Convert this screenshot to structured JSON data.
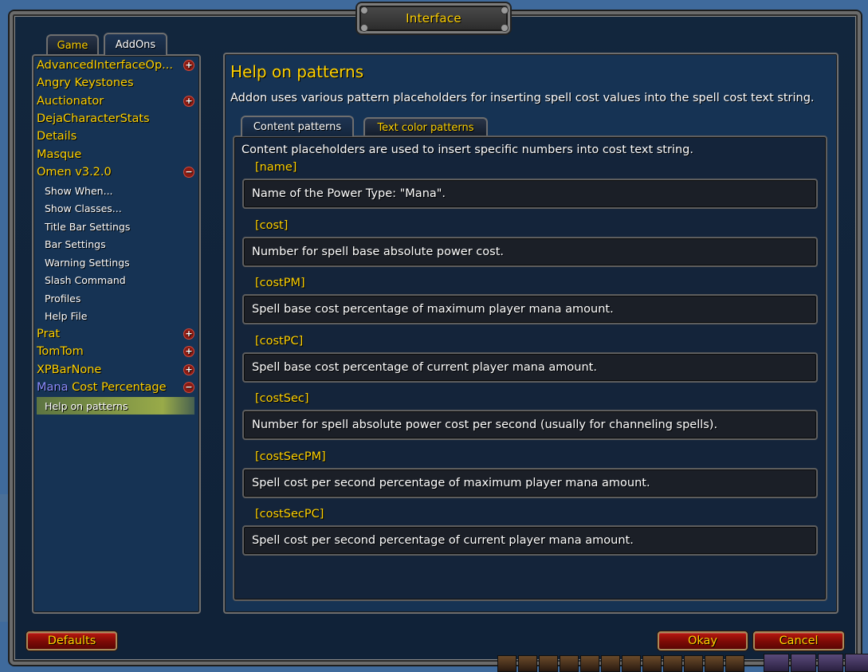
{
  "window": {
    "title": "Interface"
  },
  "tabs": {
    "game": "Game",
    "addons": "AddOns"
  },
  "sidebar": {
    "categories": [
      {
        "label": "AdvancedInterfaceOp...",
        "toggle": "+"
      },
      {
        "label": "Angry Keystones"
      },
      {
        "label": "Auctionator",
        "toggle": "+"
      },
      {
        "label": "DejaCharacterStats"
      },
      {
        "label": "Details"
      },
      {
        "label": "Masque"
      },
      {
        "label": "Omen v3.2.0",
        "toggle": "−"
      }
    ],
    "omen_children": [
      "Show When...",
      "Show Classes...",
      "Title Bar Settings",
      "Bar Settings",
      "Warning Settings",
      "Slash Command",
      "Profiles",
      "Help File"
    ],
    "categories_after": [
      {
        "label": "Prat",
        "toggle": "+"
      },
      {
        "label": "TomTom",
        "toggle": "+"
      },
      {
        "label": "XPBarNone",
        "toggle": "+"
      }
    ],
    "mana_category": {
      "label_highlight": "Mana",
      "label_rest": " Cost Percentage",
      "toggle": "−"
    },
    "selected_child": "Help on patterns"
  },
  "content": {
    "title": "Help on patterns",
    "description": "Addon uses various pattern placeholders for inserting spell cost values into the spell cost text string.",
    "tabs": {
      "content_patterns": "Content patterns",
      "text_color_patterns": "Text color patterns"
    },
    "intro": "Content placeholders are used to insert specific numbers into cost text string.",
    "placeholders": [
      {
        "name": "[name]",
        "description": "Name of the Power Type: \"Mana\"."
      },
      {
        "name": "[cost]",
        "description": "Number for spell base absolute power cost."
      },
      {
        "name": "[costPM]",
        "description": "Spell base cost percentage of maximum player mana amount."
      },
      {
        "name": "[costPC]",
        "description": "Spell base cost percentage of current player mana amount."
      },
      {
        "name": "[costSec]",
        "description": "Number for spell absolute power cost per second (usually for channeling spells)."
      },
      {
        "name": "[costSecPM]",
        "description": "Spell cost per second percentage of maximum player mana amount."
      },
      {
        "name": "[costSecPC]",
        "description": "Spell cost per second percentage of current player mana amount."
      }
    ]
  },
  "buttons": {
    "defaults": "Defaults",
    "okay": "Okay",
    "cancel": "Cancel"
  },
  "colors": {
    "gold_text": "#ffd100",
    "mana_text": "#8d8dff",
    "panel_bg": "#163354",
    "button_red": "#8a0f08"
  }
}
